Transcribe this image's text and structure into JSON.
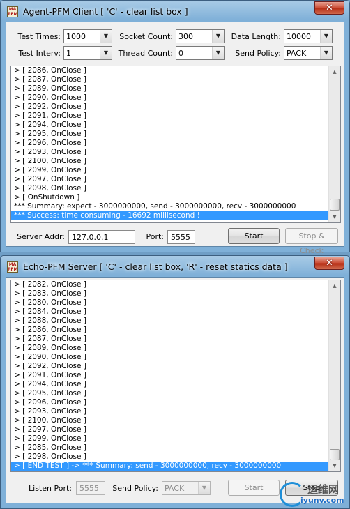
{
  "client_window": {
    "title": "Agent-PFM Client [ 'C' - clear list box ]",
    "close_glyph": "✕",
    "settings": {
      "test_times": {
        "label": "Test Times:",
        "value": "1000"
      },
      "socket_count": {
        "label": "Socket Count:",
        "value": "300"
      },
      "data_length": {
        "label": "Data Length:",
        "value": "10000"
      },
      "test_interv": {
        "label": "Test Interv:",
        "value": "1"
      },
      "thread_count": {
        "label": "Thread Count:",
        "value": "0"
      },
      "send_policy": {
        "label": "Send Policy:",
        "value": "PACK"
      }
    },
    "log": [
      "> [ 2086, OnClose ]",
      "> [ 2087, OnClose ]",
      "> [ 2089, OnClose ]",
      "> [ 2090, OnClose ]",
      "> [ 2092, OnClose ]",
      "> [ 2091, OnClose ]",
      "> [ 2094, OnClose ]",
      "> [ 2095, OnClose ]",
      "> [ 2096, OnClose ]",
      "> [ 2093, OnClose ]",
      "> [ 2100, OnClose ]",
      "> [ 2099, OnClose ]",
      "> [ 2097, OnClose ]",
      "> [ 2098, OnClose ]",
      "> [ OnShutdown ]",
      "*** Summary: expect -  3000000000, send - 3000000000, recv - 3000000000",
      "*** Success: time consuming -  16692 millisecond !"
    ],
    "selected_index": 16,
    "server_addr": {
      "label": "Server Addr:",
      "value": "127.0.0.1"
    },
    "port": {
      "label": "Port:",
      "value": "5555"
    },
    "start_label": "Start",
    "stop_label": "Stop & Check"
  },
  "server_window": {
    "title": "Echo-PFM Server [ 'C' - clear list box, 'R' - reset statics data ]",
    "close_glyph": "✕",
    "log": [
      "> [ 2082, OnClose ]",
      "> [ 2083, OnClose ]",
      "> [ 2080, OnClose ]",
      "> [ 2084, OnClose ]",
      "> [ 2088, OnClose ]",
      "> [ 2086, OnClose ]",
      "> [ 2087, OnClose ]",
      "> [ 2089, OnClose ]",
      "> [ 2090, OnClose ]",
      "> [ 2092, OnClose ]",
      "> [ 2091, OnClose ]",
      "> [ 2094, OnClose ]",
      "> [ 2095, OnClose ]",
      "> [ 2096, OnClose ]",
      "> [ 2093, OnClose ]",
      "> [ 2100, OnClose ]",
      "> [ 2097, OnClose ]",
      "> [ 2099, OnClose ]",
      "> [ 2085, OnClose ]",
      "> [ 2098, OnClose ]",
      "> [ END TEST ] ->  *** Summary: send - 3000000000, recv - 3000000000"
    ],
    "selected_index": 20,
    "listen_port": {
      "label": "Listen Port:",
      "value": "5555"
    },
    "send_policy": {
      "label": "Send Policy:",
      "value": "PACK"
    },
    "start_label": "Start",
    "stop_label": "Stop"
  },
  "watermark": {
    "cn": "运维网",
    "url": "iyunv.com"
  },
  "colors": {
    "selection": "#3399ff",
    "close_button": "#c94a32",
    "window_frame": "#7fb0d8"
  }
}
